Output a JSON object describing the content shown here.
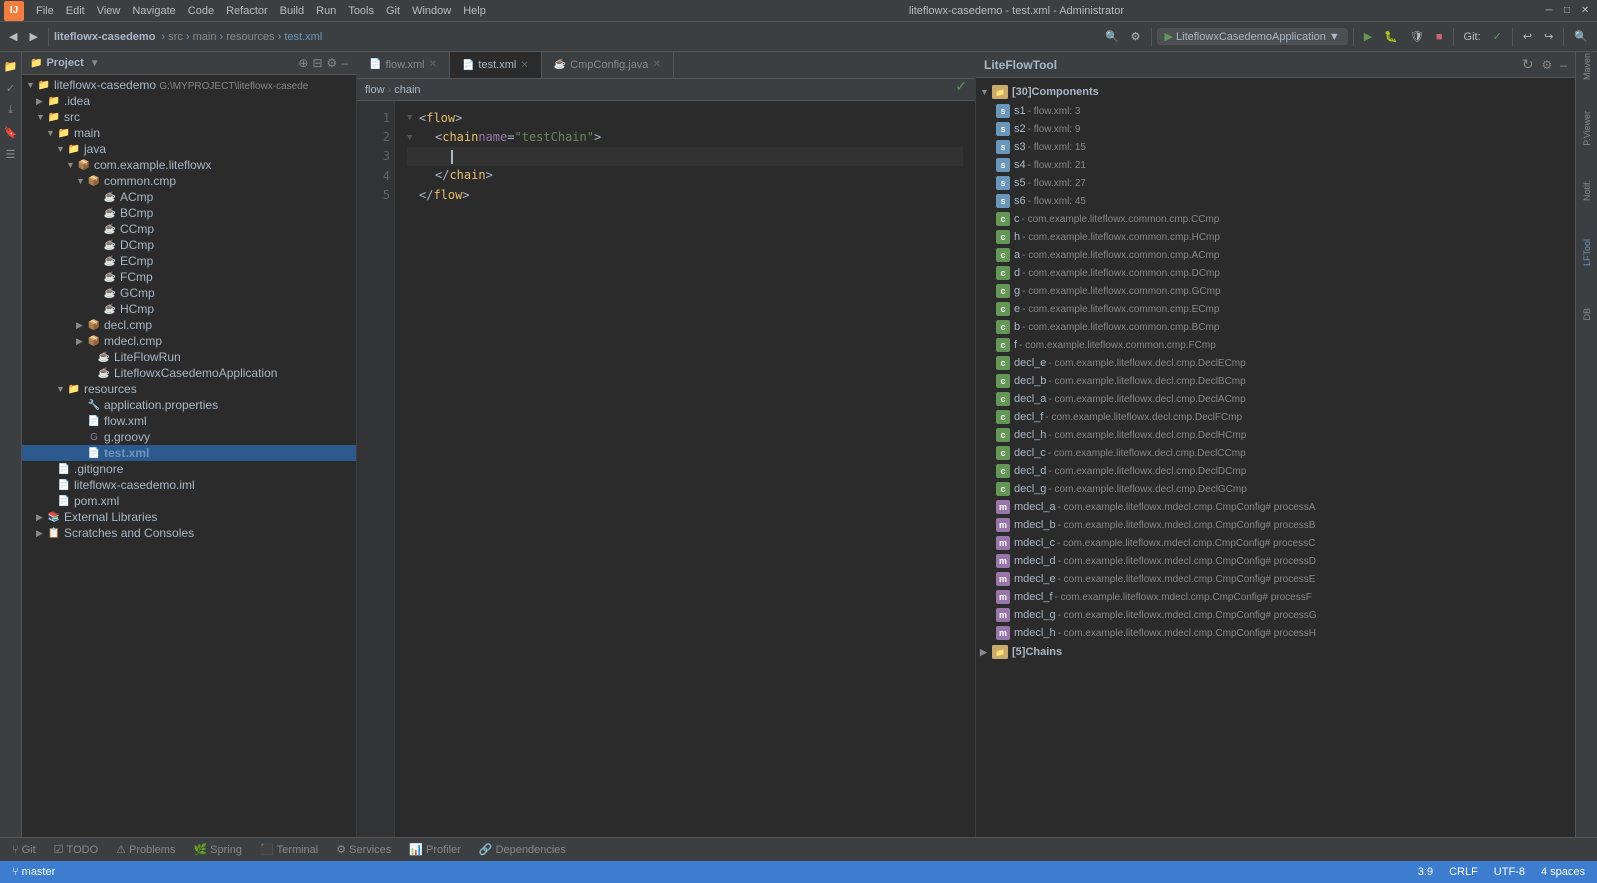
{
  "app": {
    "title": "liteflowx-casedemo - test.xml - Administrator",
    "logo": "IJ"
  },
  "menu": {
    "items": [
      "File",
      "Edit",
      "View",
      "Navigate",
      "Code",
      "Refactor",
      "Build",
      "Run",
      "Tools",
      "Git",
      "Window",
      "Help"
    ]
  },
  "toolbar": {
    "project_name": "liteflowx-casedemo",
    "breadcrumb": [
      "src",
      "main",
      "resources",
      "test.xml"
    ],
    "run_config": "LiteflowxCasedemoApplication"
  },
  "tabs": {
    "items": [
      {
        "label": "flow.xml",
        "icon": "xml",
        "active": false
      },
      {
        "label": "test.xml",
        "icon": "xml",
        "active": true
      },
      {
        "label": "CmpConfig.java",
        "icon": "java",
        "active": false
      }
    ]
  },
  "editor": {
    "lines": [
      {
        "num": "1",
        "content": "<flow>",
        "type": "tag"
      },
      {
        "num": "2",
        "content": "  <chain name=\"testChain\">",
        "type": "tag"
      },
      {
        "num": "3",
        "content": "    ",
        "type": "cursor"
      },
      {
        "num": "4",
        "content": "  </chain>",
        "type": "tag"
      },
      {
        "num": "5",
        "content": "</flow>",
        "type": "tag"
      }
    ],
    "breadcrumb": [
      "flow",
      "chain"
    ]
  },
  "project_tree": {
    "title": "Project",
    "root": "liteflowx-casedemo",
    "root_path": "G:\\MYPROJECT\\liteflowx-casede",
    "items": [
      {
        "label": ".idea",
        "type": "folder",
        "level": 1,
        "expanded": false
      },
      {
        "label": "src",
        "type": "folder",
        "level": 1,
        "expanded": true
      },
      {
        "label": "main",
        "type": "folder",
        "level": 2,
        "expanded": true
      },
      {
        "label": "java",
        "type": "folder",
        "level": 3,
        "expanded": true
      },
      {
        "label": "com.example.liteflowx",
        "type": "package",
        "level": 4,
        "expanded": true
      },
      {
        "label": "common.cmp",
        "type": "package",
        "level": 5,
        "expanded": true
      },
      {
        "label": "ACmp",
        "type": "java",
        "level": 6
      },
      {
        "label": "BCmp",
        "type": "java",
        "level": 6
      },
      {
        "label": "CCmp",
        "type": "java",
        "level": 6
      },
      {
        "label": "DCmp",
        "type": "java",
        "level": 6
      },
      {
        "label": "ECmp",
        "type": "java",
        "level": 6
      },
      {
        "label": "FCmp",
        "type": "java",
        "level": 6
      },
      {
        "label": "GCmp",
        "type": "java",
        "level": 6
      },
      {
        "label": "HCmp",
        "type": "java",
        "level": 6
      },
      {
        "label": "decl.cmp",
        "type": "package",
        "level": 5,
        "expanded": false
      },
      {
        "label": "mdecl.cmp",
        "type": "package",
        "level": 5,
        "expanded": false
      },
      {
        "label": "LiteFlowRun",
        "type": "java",
        "level": 5
      },
      {
        "label": "LiteflowxCasedemoApplication",
        "type": "java",
        "level": 5
      },
      {
        "label": "resources",
        "type": "folder",
        "level": 3,
        "expanded": true
      },
      {
        "label": "application.properties",
        "type": "props",
        "level": 4
      },
      {
        "label": "flow.xml",
        "type": "xml",
        "level": 4
      },
      {
        "label": "g.groovy",
        "type": "groovy",
        "level": 4
      },
      {
        "label": "test.xml",
        "type": "xml",
        "level": 4,
        "selected": true
      },
      {
        "label": ".gitignore",
        "type": "file",
        "level": 2
      },
      {
        "label": "liteflowx-casedemo.iml",
        "type": "iml",
        "level": 2
      },
      {
        "label": "pom.xml",
        "type": "xml",
        "level": 2
      },
      {
        "label": "External Libraries",
        "type": "folder-ext",
        "level": 1,
        "expanded": false
      },
      {
        "label": "Scratches and Consoles",
        "type": "folder-scratch",
        "level": 1,
        "expanded": false
      }
    ]
  },
  "liteflow_tool": {
    "title": "LiteFlowTool",
    "components_section": "[30]Components",
    "chains_section": "[5]Chains",
    "components": [
      {
        "id": "s1",
        "type": "s",
        "detail": "flow.xml: 3"
      },
      {
        "id": "s2",
        "type": "s",
        "detail": "flow.xml: 9"
      },
      {
        "id": "s3",
        "type": "s",
        "detail": "flow.xml: 15"
      },
      {
        "id": "s4",
        "type": "s",
        "detail": "flow.xml: 21"
      },
      {
        "id": "s5",
        "type": "s",
        "detail": "flow.xml: 27"
      },
      {
        "id": "s6",
        "type": "s",
        "detail": "flow.xml: 45"
      },
      {
        "id": "c",
        "type": "c",
        "detail": "com.example.liteflowx.common.cmp.CCmp"
      },
      {
        "id": "h",
        "type": "c",
        "detail": "com.example.liteflowx.common.cmp.HCmp"
      },
      {
        "id": "a",
        "type": "c",
        "detail": "com.example.liteflowx.common.cmp.ACmp"
      },
      {
        "id": "d",
        "type": "c",
        "detail": "com.example.liteflowx.common.cmp.DCmp"
      },
      {
        "id": "g",
        "type": "c",
        "detail": "com.example.liteflowx.common.cmp.GCmp"
      },
      {
        "id": "e",
        "type": "c",
        "detail": "com.example.liteflowx.common.cmp.ECmp"
      },
      {
        "id": "b",
        "type": "c",
        "detail": "com.example.liteflowx.common.cmp.BCmp"
      },
      {
        "id": "f",
        "type": "c",
        "detail": "com.example.liteflowx.common.cmp.FCmp"
      },
      {
        "id": "decl_e",
        "type": "c",
        "detail": "com.example.liteflowx.decl.cmp.DeclECmp"
      },
      {
        "id": "decl_b",
        "type": "c",
        "detail": "com.example.liteflowx.decl.cmp.DeclBCmp"
      },
      {
        "id": "decl_a",
        "type": "c",
        "detail": "com.example.liteflowx.decl.cmp.DeclACmp"
      },
      {
        "id": "decl_f",
        "type": "c",
        "detail": "com.example.liteflowx.decl.cmp.DeclFCmp"
      },
      {
        "id": "decl_h",
        "type": "c",
        "detail": "com.example.liteflowx.decl.cmp.DeclHCmp"
      },
      {
        "id": "decl_c",
        "type": "c",
        "detail": "com.example.liteflowx.decl.cmp.DeclCCmp"
      },
      {
        "id": "decl_d",
        "type": "c",
        "detail": "com.example.liteflowx.decl.cmp.DeclDCmp"
      },
      {
        "id": "decl_g",
        "type": "c",
        "detail": "com.example.liteflowx.decl.cmp.DeclGCmp"
      },
      {
        "id": "mdecl_a",
        "type": "m",
        "detail": "com.example.liteflowx.mdecl.cmp.CmpConfig# processA"
      },
      {
        "id": "mdecl_b",
        "type": "m",
        "detail": "com.example.liteflowx.mdecl.cmp.CmpConfig# processB"
      },
      {
        "id": "mdecl_c",
        "type": "m",
        "detail": "com.example.liteflowx.mdecl.cmp.CmpConfig# processC"
      },
      {
        "id": "mdecl_d",
        "type": "m",
        "detail": "com.example.liteflowx.mdecl.cmp.CmpConfig# processD"
      },
      {
        "id": "mdecl_e",
        "type": "m",
        "detail": "com.example.liteflowx.mdecl.cmp.CmpConfig# processE"
      },
      {
        "id": "mdecl_f",
        "type": "m",
        "detail": "com.example.liteflowx.mdecl.cmp.CmpConfig# processF"
      },
      {
        "id": "mdecl_g",
        "type": "m",
        "detail": "com.example.liteflowx.mdecl.cmp.CmpConfig# processG"
      },
      {
        "id": "mdecl_h",
        "type": "m",
        "detail": "com.example.liteflowx.mdecl.cmp.CmpConfig# processH"
      }
    ]
  },
  "bottom_tabs": [
    {
      "label": "Git",
      "icon": "git"
    },
    {
      "label": "TODO",
      "icon": "todo"
    },
    {
      "label": "Problems",
      "icon": "problems"
    },
    {
      "label": "Spring",
      "icon": "spring"
    },
    {
      "label": "Terminal",
      "icon": "terminal"
    },
    {
      "label": "Services",
      "icon": "services"
    },
    {
      "label": "Profiler",
      "icon": "profiler"
    },
    {
      "label": "Dependencies",
      "icon": "dependencies"
    }
  ],
  "status_bar": {
    "line_col": "3:9",
    "line_sep": "CRLF",
    "encoding": "UTF-8",
    "indent": "4 spaces",
    "branch": "master"
  }
}
